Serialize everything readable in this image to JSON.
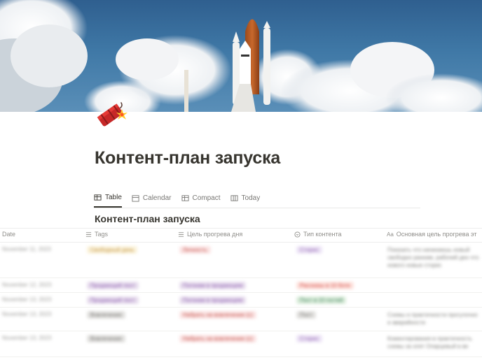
{
  "cover": {
    "description_icon": "rocket-launch-cover"
  },
  "page": {
    "icon": "firecracker-icon",
    "title": "Контент-план запуска"
  },
  "views": [
    {
      "label": "Table",
      "icon": "table-icon",
      "active": true
    },
    {
      "label": "Calendar",
      "icon": "calendar-icon",
      "active": false
    },
    {
      "label": "Compact",
      "icon": "table-icon",
      "active": false
    },
    {
      "label": "Today",
      "icon": "board-icon",
      "active": false
    }
  ],
  "database": {
    "title": "Контент-план запуска",
    "columns": {
      "date": "Date",
      "tags": "Tags",
      "goal": "Цель прогрева дня",
      "type": "Тип контента",
      "main": "Основная цель прогрева эт"
    },
    "rows": [
      {
        "date": "November 11, 2023",
        "tag": "Свободный день",
        "tag_color": "#fbf3db",
        "tag_text": "#c29343",
        "goal": "Личность",
        "goal_color": "#fbe4e4",
        "goal_text": "#c4554d",
        "type": "Сторис",
        "type_color": "#ede4f6",
        "type_text": "#9065b0",
        "main": "Показать что начинаешь новый свободно ранним, рабочий ден что нового новые сторис"
      },
      {
        "date": "November 12, 2023",
        "tag": "Продающий пост",
        "tag_color": "#e8deee",
        "tag_text": "#8d5fb0",
        "goal": "Погонам в продающем",
        "goal_color": "#e8deee",
        "goal_text": "#8d5fb0",
        "type": "Рассказы в 10 боте",
        "type_color": "#fde2dd",
        "type_text": "#d44c47",
        "main": ""
      },
      {
        "date": "November 13, 2023",
        "tag": "Продающий пост",
        "tag_color": "#e8deee",
        "tag_text": "#8d5fb0",
        "goal": "Погонам в продающем",
        "goal_color": "#e8deee",
        "goal_text": "#8d5fb0",
        "type": "Пост в 10 гостей",
        "type_color": "#dbeddb",
        "type_text": "#448361",
        "main": ""
      },
      {
        "date": "November 13, 2023",
        "tag": "Вовлечение",
        "tag_color": "#e3e2e0",
        "tag_text": "#787774",
        "goal": "Набрать на вовлечение (с)",
        "goal_color": "#fbe4e4",
        "goal_text": "#c4554d",
        "type": "Пост",
        "type_color": "#e3e2e0",
        "type_text": "#787774",
        "main": "Схемы и практичности прогулочно и аварийности"
      },
      {
        "date": "November 13, 2023",
        "tag": "Вовлечение",
        "tag_color": "#e3e2e0",
        "tag_text": "#787774",
        "goal": "Набрать на вовлечение (с)",
        "goal_color": "#fbe4e4",
        "goal_text": "#c4554d",
        "type": "Сторис",
        "type_color": "#ede4f6",
        "type_text": "#9065b0",
        "main": "Коментирования в практичность схемы за опят Опарцевый в ве"
      }
    ]
  }
}
